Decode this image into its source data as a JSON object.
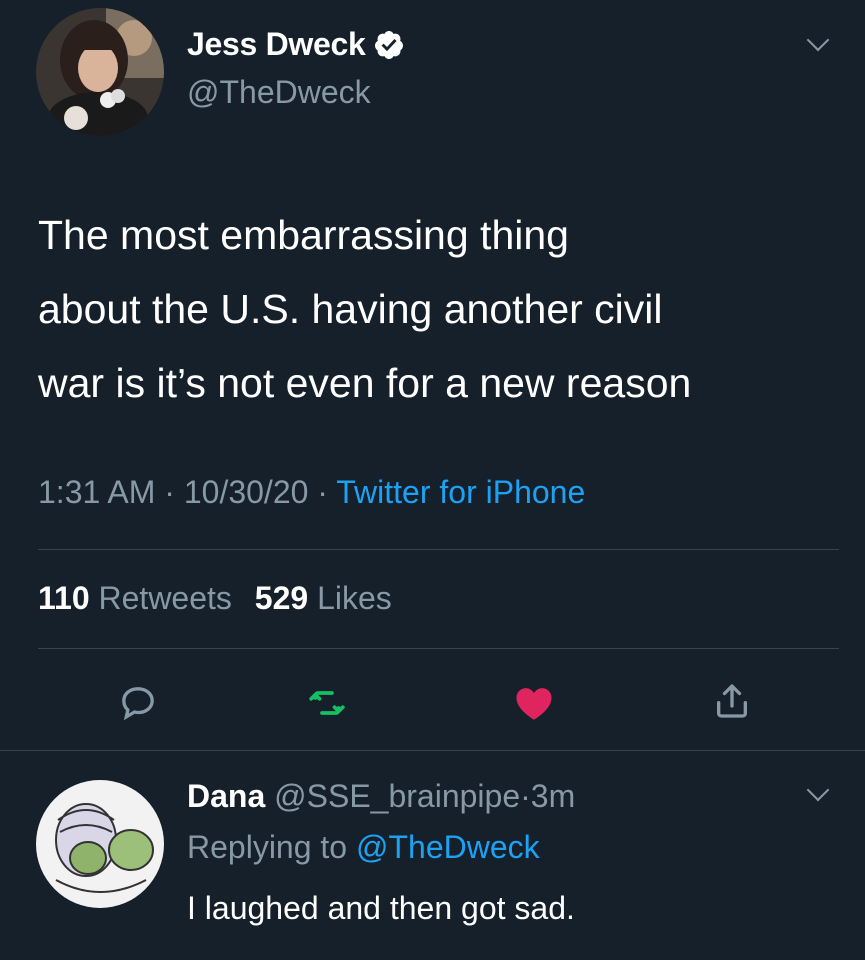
{
  "tweet": {
    "author_name": "Jess Dweck",
    "author_handle": "@TheDweck",
    "verified_icon": "verified-badge-icon",
    "text_lines": [
      "The most embarrassing thing",
      "about the U.S. having another civil",
      "war is it’s not even for a new reason"
    ],
    "time": "1:31 AM",
    "date": "10/30/20",
    "sep": "·",
    "source": "Twitter for iPhone",
    "retweets_count": "110",
    "retweets_label": "Retweets",
    "likes_count": "529",
    "likes_label": "Likes",
    "actions": [
      "reply-icon",
      "retweet-icon",
      "like-icon",
      "share-icon"
    ],
    "colors": {
      "retweet": "#17bf63",
      "like": "#e0245e",
      "link": "#1da1f2",
      "muted": "#8899a6",
      "background": "#15202b"
    }
  },
  "reply": {
    "author_name": "Dana",
    "author_handle": "@SSE_brainpipe",
    "sep": "·",
    "time": "3m",
    "replying_to_label": "Replying to",
    "replying_to_handle": "@TheDweck",
    "text": "I laughed and then got sad."
  }
}
